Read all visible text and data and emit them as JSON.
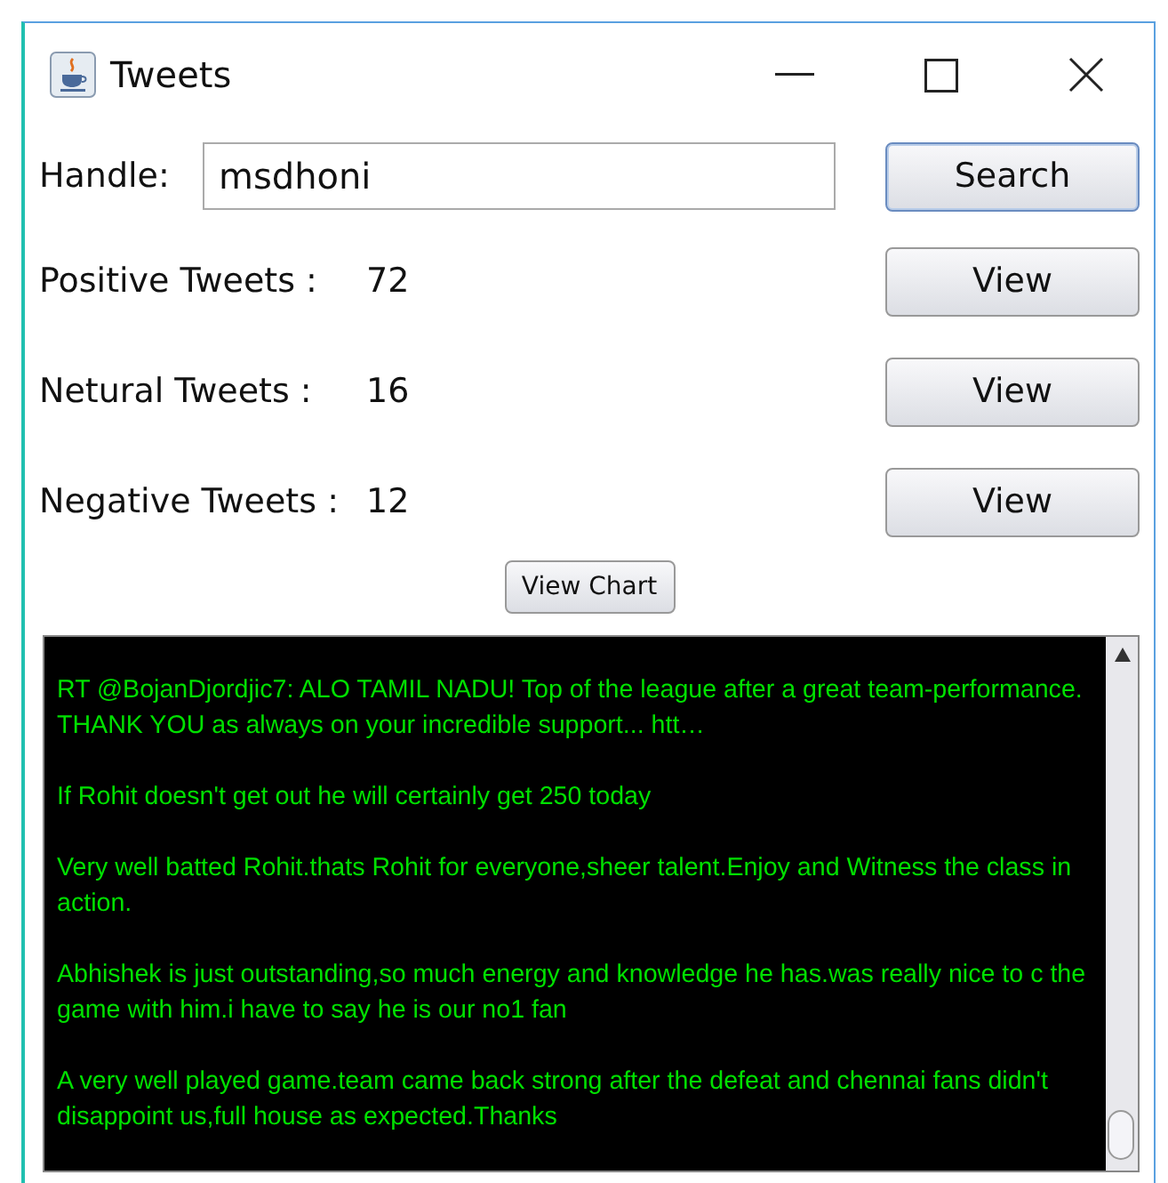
{
  "window": {
    "title": "Tweets"
  },
  "handle": {
    "label": "Handle:",
    "value": "msdhoni"
  },
  "search_button": "Search",
  "counts": [
    {
      "label": "Positive Tweets :",
      "value": "72",
      "button": "View"
    },
    {
      "label": "Netural Tweets :",
      "value": "16",
      "button": "View"
    },
    {
      "label": "Negative Tweets :",
      "value": "12",
      "button": "View"
    }
  ],
  "chart_button": "View Chart",
  "tweets": [
    "RT @BojanDjordjic7: ALO TAMIL NADU! Top of the league after a great team-performance. THANK YOU as always on your incredible support... htt…",
    "If Rohit doesn't get out he will certainly get 250 today",
    "Very well batted Rohit.thats Rohit for everyone,sheer talent.Enjoy and Witness the class in action.",
    "Abhishek is just outstanding,so much energy and knowledge he has.was really nice to c the game with him.i have to say he is our no1 fan",
    "A very well played game.team came back strong after the defeat and chennai fans didn't disappoint us,full house as expected.Thanks"
  ]
}
